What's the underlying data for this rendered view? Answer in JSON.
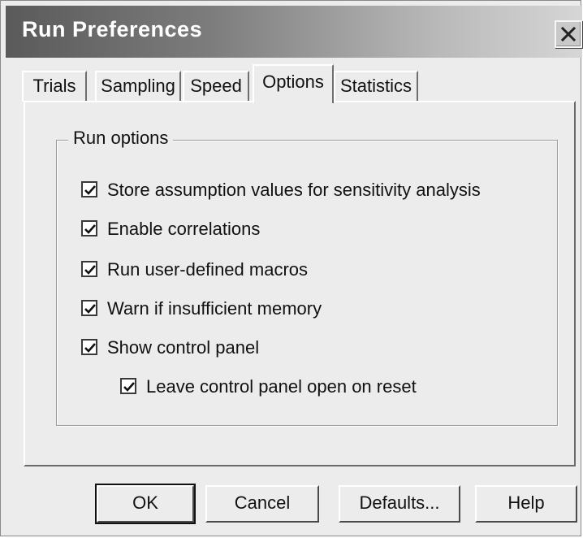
{
  "window": {
    "title": "Run Preferences",
    "close_icon": "close-icon"
  },
  "tabs": [
    {
      "label": "Trials",
      "active": false
    },
    {
      "label": "Sampling",
      "active": false
    },
    {
      "label": "Speed",
      "active": false
    },
    {
      "label": "Options",
      "active": true
    },
    {
      "label": "Statistics",
      "active": false
    }
  ],
  "run_options": {
    "group_label": "Run options",
    "items": [
      {
        "label": "Store assumption values for sensitivity analysis",
        "checked": true
      },
      {
        "label": "Enable correlations",
        "checked": true
      },
      {
        "label": "Run user-defined macros",
        "checked": true
      },
      {
        "label": "Warn if insufficient memory",
        "checked": true
      },
      {
        "label": "Show control panel",
        "checked": true
      },
      {
        "label": "Leave control panel open on reset",
        "checked": true
      }
    ]
  },
  "buttons": {
    "ok": "OK",
    "cancel": "Cancel",
    "defaults": "Defaults...",
    "help": "Help"
  }
}
